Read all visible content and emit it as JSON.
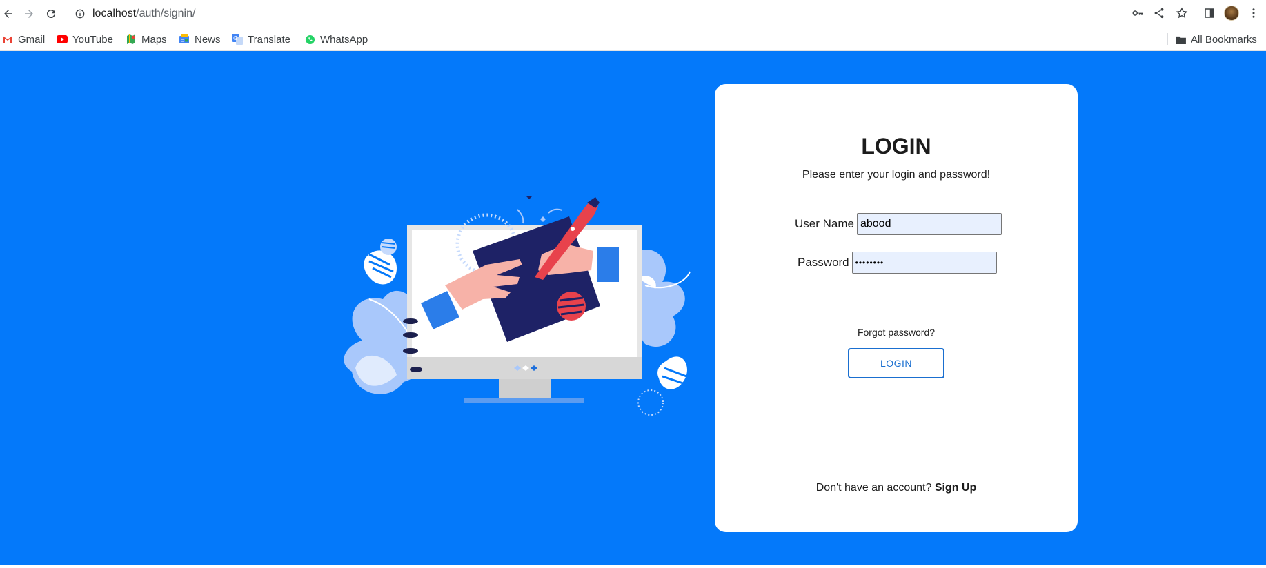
{
  "browser": {
    "url_host": "localhost",
    "url_path": "/auth/signin/",
    "bookmarks": [
      {
        "label": "Gmail",
        "icon": "gmail-icon"
      },
      {
        "label": "YouTube",
        "icon": "youtube-icon"
      },
      {
        "label": "Maps",
        "icon": "maps-icon"
      },
      {
        "label": "News",
        "icon": "news-icon"
      },
      {
        "label": "Translate",
        "icon": "translate-icon"
      },
      {
        "label": "WhatsApp",
        "icon": "whatsapp-icon"
      }
    ],
    "all_bookmarks_label": "All Bookmarks"
  },
  "page": {
    "background_color": "#0479fa",
    "illustration": "computer-with-hands-signing-document"
  },
  "login_card": {
    "title": "LOGIN",
    "subtitle": "Please enter your login and password!",
    "username_label": "User Name",
    "username_value": "abood",
    "password_label": "Password",
    "password_value": "••••••••",
    "forgot_password": "Forgot password?",
    "login_button": "LOGIN",
    "no_account_text": "Don't have an account?",
    "signup_link": "Sign Up",
    "accent_color": "#1a6fd0"
  }
}
